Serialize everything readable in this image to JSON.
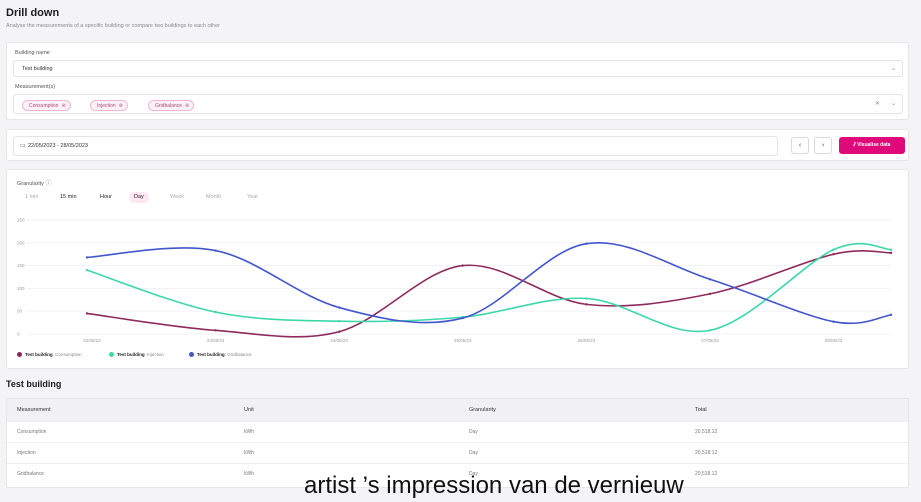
{
  "header": {
    "title": "Drill down",
    "subtitle": "Analyse the measurements of a specific building or compare two buildings to each other"
  },
  "filters": {
    "building_label": "Building name",
    "building_value": "Test building",
    "measurements_label": "Measurement(s)",
    "chips": [
      "Consumption",
      "Injection",
      "Gridbalance"
    ],
    "clear_icon": "close-icon",
    "chevron_icon": "chevron-down-icon"
  },
  "date_bar": {
    "range": "22/05/2023 - 28/05/2023",
    "prev": "‹",
    "next": "›",
    "visualise_label": "Visualise data"
  },
  "granularity": {
    "label": "Granularity",
    "options": [
      "1 min",
      "15 min",
      "Hour",
      "Day",
      "Week",
      "Month",
      "Year"
    ],
    "selected": "Day"
  },
  "chart_data": {
    "type": "line",
    "title": "",
    "xlabel": "",
    "ylabel": "",
    "x": [
      "22/05/23",
      "23/05/23",
      "24/05/23",
      "25/05/23",
      "26/05/23",
      "27/05/23",
      "28/05/23"
    ],
    "ylim": [
      0,
      250
    ],
    "yticks": [
      0,
      50,
      100,
      150,
      200,
      250
    ],
    "grid": true,
    "legend_position": "bottom-left",
    "series": [
      {
        "name": "Test building: Consumption",
        "color": "#8e2a5e",
        "values": [
          45,
          8,
          5,
          150,
          65,
          88,
          175
        ]
      },
      {
        "name": "Test building: Injection",
        "color": "#3ed8a8",
        "values": [
          140,
          48,
          28,
          37,
          78,
          8,
          185
        ]
      },
      {
        "name": "Test building: Gridbalance",
        "color": "#4356cc",
        "values": [
          168,
          183,
          58,
          35,
          198,
          120,
          27
        ]
      }
    ],
    "start_x": "22/05/23",
    "end_values": {
      "Test building: Consumption": 178,
      "Test building: Injection": 185,
      "Test building: Gridbalance": 42
    }
  },
  "legend": [
    {
      "bold": "Test building",
      "rest": ": Consumption",
      "color": "#8e2a5e"
    },
    {
      "bold": "Test building",
      "rest": ": Injection",
      "color": "#3ed8a8"
    },
    {
      "bold": "Test building",
      "rest": ": Gridbalance",
      "color": "#4356cc"
    }
  ],
  "table": {
    "title": "Test building",
    "headers": [
      "Measurement",
      "Unit",
      "Granularity",
      "Total"
    ],
    "rows": [
      [
        "Consumption",
        "kWh",
        "Day",
        "20,518.12"
      ],
      [
        "Injection",
        "kWh",
        "Day",
        "20,518.12"
      ],
      [
        "Gridbalance",
        "kWh",
        "Day",
        "20,518.12"
      ]
    ]
  },
  "caption": "artist ’s impression van de vernieuw"
}
